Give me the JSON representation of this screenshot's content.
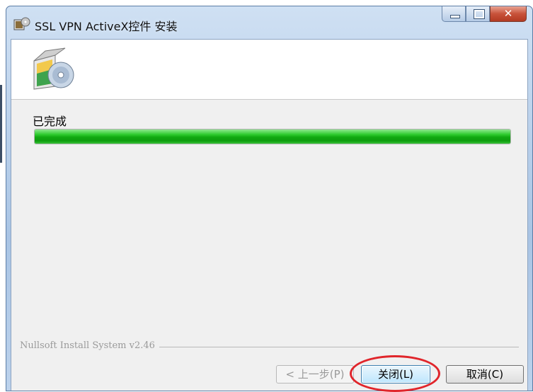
{
  "window": {
    "title": "SSL VPN ActiveX控件 安装",
    "app_icon": "installer-icon",
    "caption_buttons": [
      "minimize-icon",
      "maximize-icon",
      "close-icon"
    ]
  },
  "banner": {
    "icon": "software-box-cd-icon"
  },
  "main": {
    "status_label": "已完成",
    "progress_fraction": 1.0,
    "progress_color": "#1eb91e"
  },
  "footer": {
    "brand_text": "Nullsoft Install System v2.46"
  },
  "buttons": {
    "back_label": "< 上一步(P)",
    "close_label": "关闭(L)",
    "cancel_label": "取消(C)"
  },
  "annotation": {
    "highlight_color": "#e0252b"
  }
}
